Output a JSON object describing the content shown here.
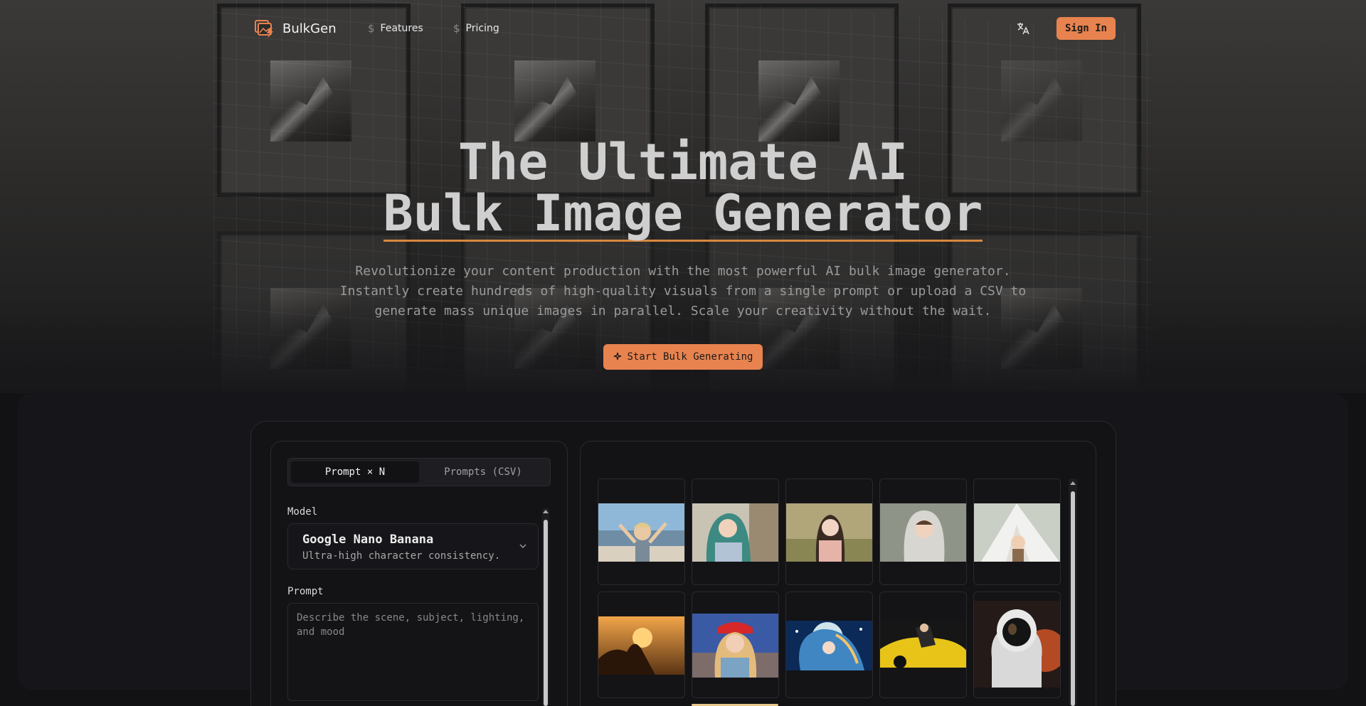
{
  "nav": {
    "brand": "BulkGen",
    "links": [
      {
        "label": "Features",
        "icon": "dollar-icon"
      },
      {
        "label": "Pricing",
        "icon": "dollar-icon"
      }
    ],
    "language_icon": "translate-icon",
    "signin_label": "Sign In"
  },
  "hero": {
    "title_line1": "The Ultimate AI",
    "title_line2": "Bulk Image Generator",
    "subtitle": "Revolutionize your content production with the most powerful AI bulk image generator. Instantly create hundreds of high-quality visuals from a single prompt or upload a CSV to generate mass unique images in parallel. Scale your creativity without the wait.",
    "cta_label": "Start Bulk Generating",
    "cta_icon": "sparkle-icon"
  },
  "generator": {
    "tabs": [
      {
        "label": "Prompt × N",
        "active": true
      },
      {
        "label": "Prompts (CSV)",
        "active": false
      }
    ],
    "model_label": "Model",
    "model": {
      "name": "Google Nano Banana",
      "description": "Ultra-high character consistency."
    },
    "prompt_label": "Prompt",
    "prompt_placeholder": "Describe the scene, subject, lighting, and mood",
    "prompt_value": ""
  },
  "colors": {
    "accent": "#e8834f",
    "underline": "#d9883e",
    "background": "#121214"
  },
  "gallery": {
    "tiles": [
      {
        "name": "child-beach-image"
      },
      {
        "name": "green-hair-woman-image"
      },
      {
        "name": "girl-field-image"
      },
      {
        "name": "girl-hoodie-image"
      },
      {
        "name": "child-tent-image"
      },
      {
        "name": "sunset-silhouette-image"
      },
      {
        "name": "racing-fan-image"
      },
      {
        "name": "anime-girl-night-image"
      },
      {
        "name": "yellow-car-image"
      },
      {
        "name": "astronaut-image"
      }
    ]
  }
}
